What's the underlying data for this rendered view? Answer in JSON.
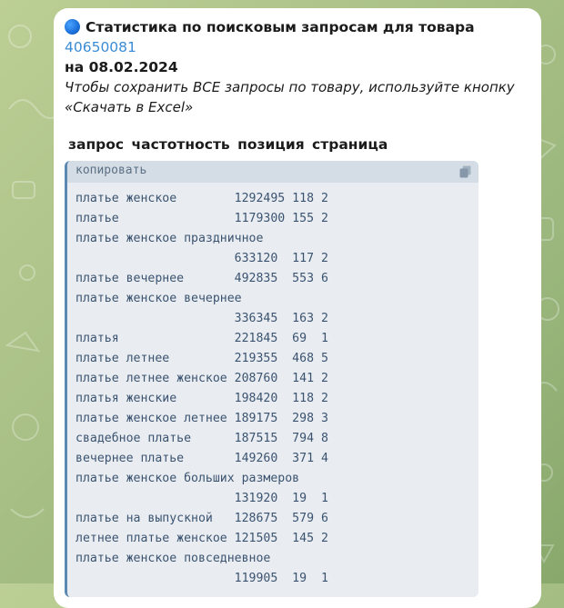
{
  "message": {
    "title": "Статистика по поисковым запросам для товара ",
    "product_id": "40650081",
    "date_line": "на 08.02.2024",
    "hint": "Чтобы сохранить ВСЕ запросы по товару, используйте кнопку «Скачать  в Excel»",
    "columns_header": "запрос  частотность  позиция  страница"
  },
  "code_block": {
    "copy_label": "копировать",
    "rows": [
      {
        "query": "платье женское",
        "freq": "1292495",
        "pos": "118",
        "page": "2",
        "wrap": false
      },
      {
        "query": "платье",
        "freq": "1179300",
        "pos": "155",
        "page": "2",
        "wrap": false
      },
      {
        "query": "платье женское праздничное",
        "freq": "633120",
        "pos": "117",
        "page": "2",
        "wrap": true
      },
      {
        "query": "платье вечернее",
        "freq": "492835",
        "pos": "553",
        "page": "6",
        "wrap": false
      },
      {
        "query": "платье женское вечернее",
        "freq": "336345",
        "pos": "163",
        "page": "2",
        "wrap": true
      },
      {
        "query": "платья",
        "freq": "221845",
        "pos": "69",
        "page": "1",
        "wrap": false
      },
      {
        "query": "платье летнее",
        "freq": "219355",
        "pos": "468",
        "page": "5",
        "wrap": false
      },
      {
        "query": "платье летнее женское",
        "freq": "208760",
        "pos": "141",
        "page": "2",
        "wrap": false
      },
      {
        "query": "платья женские",
        "freq": "198420",
        "pos": "118",
        "page": "2",
        "wrap": false
      },
      {
        "query": "платье женское летнее",
        "freq": "189175",
        "pos": "298",
        "page": "3",
        "wrap": false
      },
      {
        "query": "свадебное платье",
        "freq": "187515",
        "pos": "794",
        "page": "8",
        "wrap": false
      },
      {
        "query": "вечернее платье",
        "freq": "149260",
        "pos": "371",
        "page": "4",
        "wrap": false
      },
      {
        "query": "платье женское больших размеров",
        "freq": "131920",
        "pos": "19",
        "page": "1",
        "wrap": true
      },
      {
        "query": "платье на выпускной",
        "freq": "128675",
        "pos": "579",
        "page": "6",
        "wrap": false
      },
      {
        "query": "летнее платье женское",
        "freq": "121505",
        "pos": "145",
        "page": "2",
        "wrap": false
      },
      {
        "query": "платье женское повседневное",
        "freq": "119905",
        "pos": "19",
        "page": "1",
        "wrap": true
      }
    ]
  },
  "colors": {
    "accent_link": "#3a8cd6",
    "code_text": "#3b5370",
    "code_border": "#5b89b1",
    "code_bg": "#e9edf1"
  },
  "icons": {
    "status_dot": "blue-circle-icon",
    "copy": "copy-icon"
  }
}
